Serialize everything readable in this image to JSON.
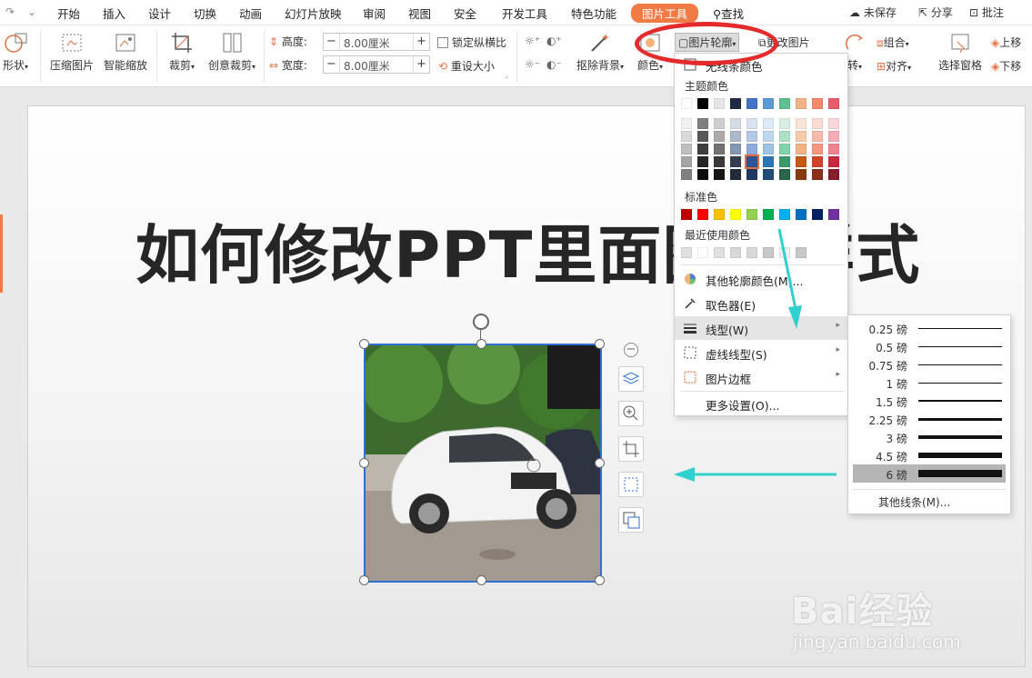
{
  "menu": {
    "tabs": [
      "开始",
      "插入",
      "设计",
      "切换",
      "动画",
      "幻灯片放映",
      "审阅",
      "视图",
      "安全",
      "开发工具",
      "特色功能",
      "图片工具"
    ],
    "search": "查找",
    "right": [
      "未保存",
      "分享",
      "批注"
    ]
  },
  "ribbon": {
    "shape": "形状",
    "compress": "压缩图片",
    "smart_zoom": "智能缩放",
    "crop": "裁剪",
    "creative_crop": "创意裁剪",
    "height_label": "高度:",
    "height_value": "8.00厘米",
    "width_label": "宽度:",
    "width_value": "8.00厘米",
    "lock_ratio": "锁定纵横比",
    "reset_size": "重设大小",
    "remove_bg": "抠除背景",
    "color": "颜色",
    "outline": "图片轮廓",
    "change_picture": "更改图片",
    "rotate": "转",
    "group": "组合",
    "align": "对齐",
    "selection_pane": "选择窗格",
    "bring_forward": "上移",
    "send_backward": "下移"
  },
  "slide": {
    "title": "如何修改PPT里面图片样式"
  },
  "dropdown": {
    "no_outline": "无线条颜色",
    "theme_colors_label": "主题颜色",
    "theme_row": [
      "#ffffff",
      "#000000",
      "#e7e6e6",
      "#1f2a44",
      "#4472c4",
      "#5b9bd5",
      "#5fbf8f",
      "#f4b183",
      "#f4896b",
      "#e75c6b"
    ],
    "theme_shades": [
      [
        "#f2f2f2",
        "#7f7f7f",
        "#d0cece",
        "#d6dce5",
        "#d9e2f3",
        "#deebf7",
        "#d5f0e2",
        "#fbe5d6",
        "#fbdcd4",
        "#f9d6da"
      ],
      [
        "#d9d9d9",
        "#595959",
        "#aeaaaa",
        "#adb9ca",
        "#b4c7e7",
        "#bdd7ee",
        "#ace1c6",
        "#f8cbad",
        "#f7b9aa",
        "#f4adb6"
      ],
      [
        "#bfbfbf",
        "#3f3f3f",
        "#757171",
        "#8497b0",
        "#8faadc",
        "#9dc3e6",
        "#82d3aa",
        "#f4b183",
        "#f3977f",
        "#ef8491"
      ],
      [
        "#a6a6a6",
        "#262626",
        "#3a3838",
        "#333f50",
        "#2f5597",
        "#2e75b6",
        "#3a9a6a",
        "#c55a11",
        "#d0452a",
        "#c9283d"
      ],
      [
        "#808080",
        "#0d0d0d",
        "#171616",
        "#222a35",
        "#1f3864",
        "#1f4e79",
        "#276748",
        "#843c0c",
        "#8b2e1c",
        "#861b29"
      ]
    ],
    "standard_colors_label": "标准色",
    "standard_colors": [
      "#c00000",
      "#ff0000",
      "#ffc000",
      "#ffff00",
      "#92d050",
      "#00b050",
      "#00b0f0",
      "#0070c0",
      "#002060",
      "#7030a0"
    ],
    "recent_colors_label": "最近使用颜色",
    "recent_colors": [
      "#e0e0e0",
      "#ffffff",
      "#e0e0e0",
      "#d8d8d8",
      "#d8d8d8",
      "#c8c8c8",
      "#f0f0f0",
      "#c8c8c8"
    ],
    "more_outline_colors": "其他轮廓颜色(M)...",
    "eyedropper": "取色器(E)",
    "line_type": "线型(W)",
    "dash_type": "虚线线型(S)",
    "picture_border": "图片边框",
    "more_settings": "更多设置(O)..."
  },
  "submenu": {
    "weights": [
      {
        "label": "0.25 磅",
        "pt": 0.25
      },
      {
        "label": "0.5 磅",
        "pt": 0.5
      },
      {
        "label": "0.75 磅",
        "pt": 0.75
      },
      {
        "label": "1 磅",
        "pt": 1
      },
      {
        "label": "1.5 磅",
        "pt": 1.5
      },
      {
        "label": "2.25 磅",
        "pt": 2.25
      },
      {
        "label": "3 磅",
        "pt": 3
      },
      {
        "label": "4.5 磅",
        "pt": 4.5
      },
      {
        "label": "6 磅",
        "pt": 6
      }
    ],
    "more_lines": "其他线条(M)..."
  },
  "watermark": {
    "brand": "Bai经验",
    "url": "jingyan.baidu.com"
  },
  "colors": {
    "accent_tab": "#f07b45",
    "selection": "#2f6fd6",
    "annotation_red": "#e42a2a",
    "annotation_arrow": "#2fd0d0"
  }
}
